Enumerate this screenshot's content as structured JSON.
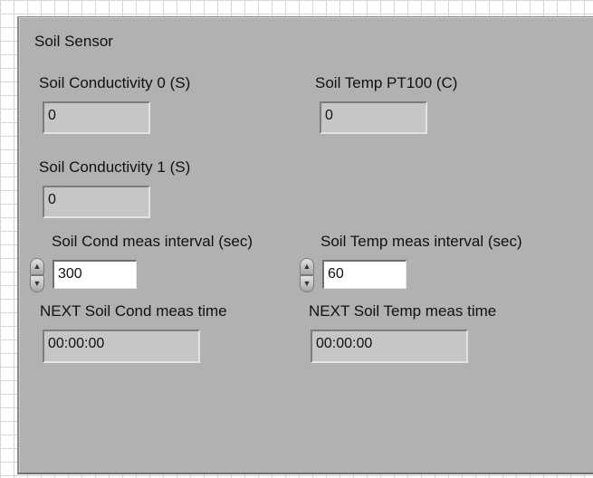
{
  "panel": {
    "title": "Soil Sensor"
  },
  "soil_cond_0": {
    "label": "Soil Conductivity 0 (S)",
    "value": "0"
  },
  "soil_cond_1": {
    "label": "Soil Conductivity 1 (S)",
    "value": "0"
  },
  "soil_temp": {
    "label": "Soil Temp PT100 (C)",
    "value": "0"
  },
  "cond_interval": {
    "label": "Soil Cond meas interval (sec)",
    "value": "300"
  },
  "temp_interval": {
    "label": "Soil Temp meas interval (sec)",
    "value": "60"
  },
  "next_cond": {
    "label": "NEXT Soil Cond meas time",
    "value": "00:00:00"
  },
  "next_temp": {
    "label": "NEXT Soil Temp meas time",
    "value": "00:00:00"
  },
  "icons": {
    "increment": "increment-arrow-icon",
    "decrement": "decrement-arrow-icon"
  }
}
